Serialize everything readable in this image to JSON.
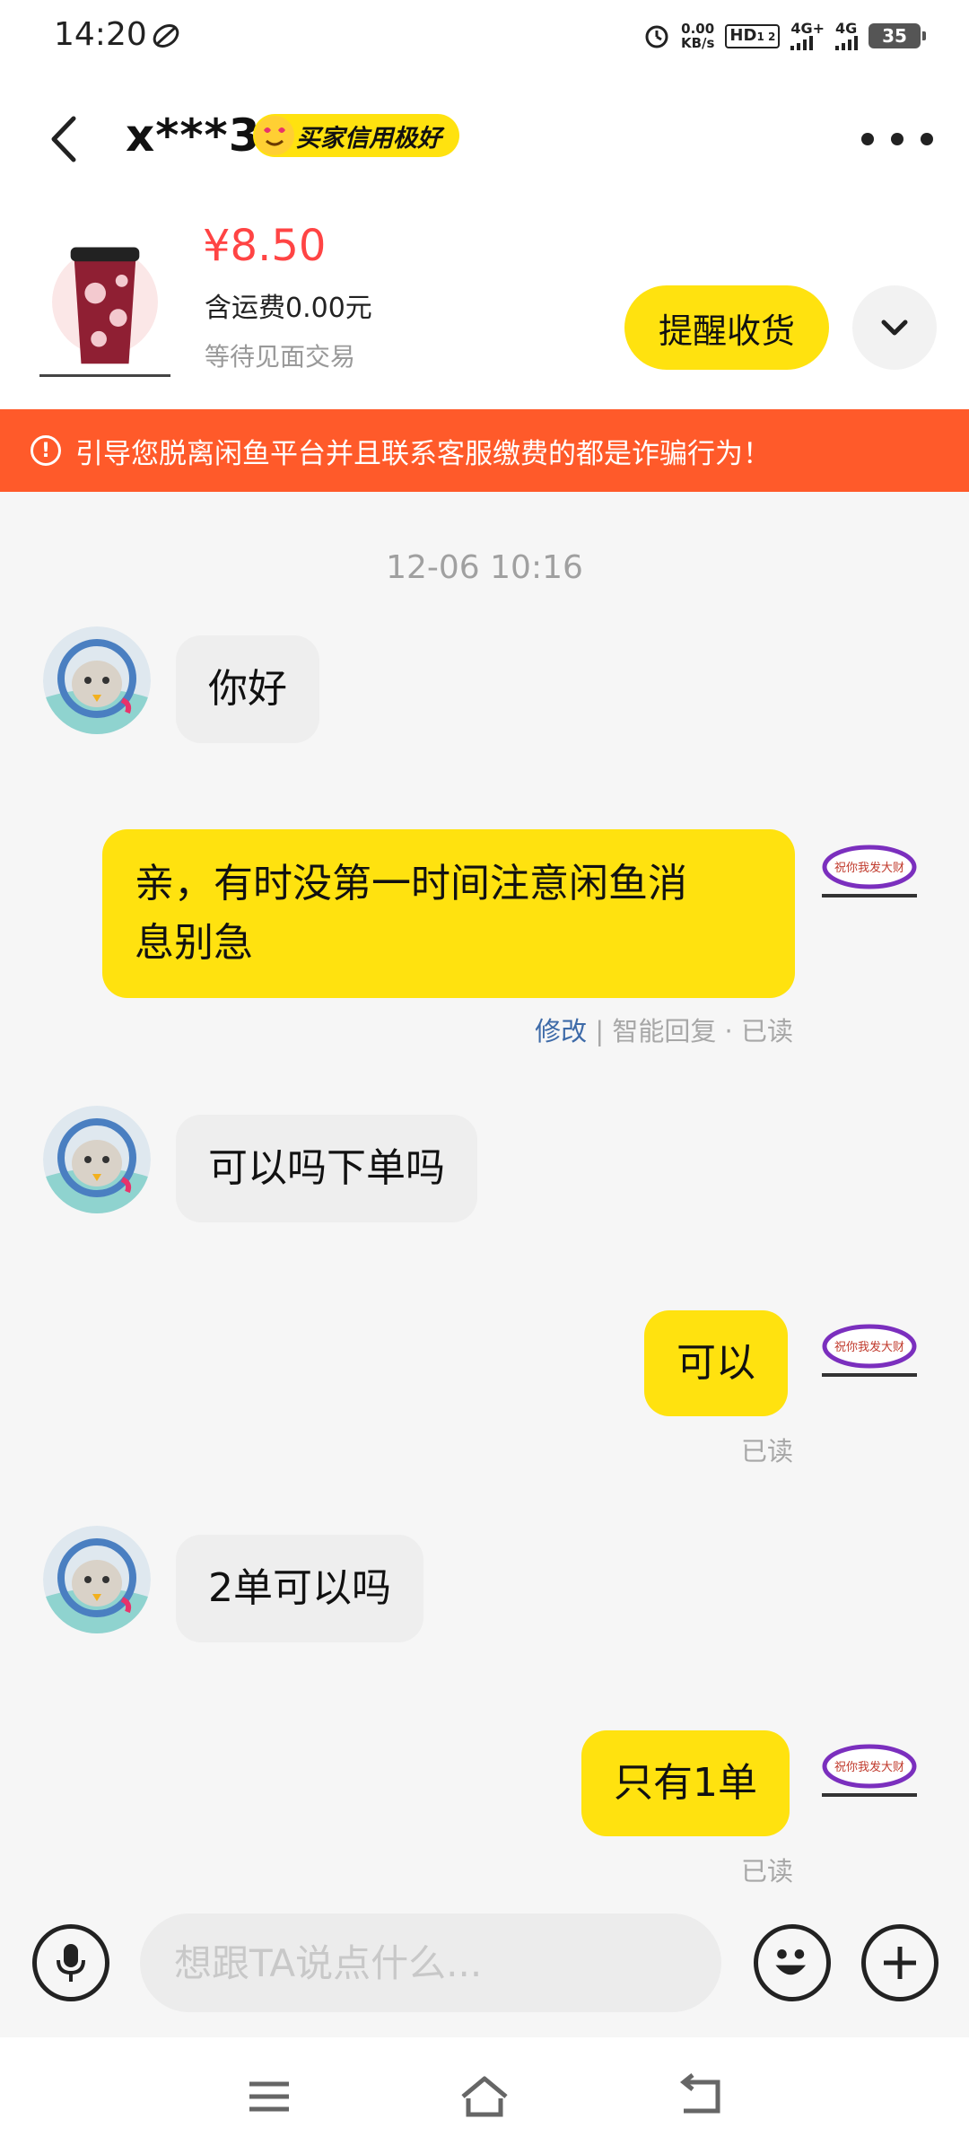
{
  "status_bar": {
    "time": "14:20",
    "net_speed_value": "0.00",
    "net_speed_unit": "KB/s",
    "hd_label": "HD",
    "hd_sims": "1 2",
    "signal1": "4G+",
    "signal2": "4G",
    "battery": "35"
  },
  "header": {
    "user_name": "x***3",
    "credit_badge": "买家信用极好"
  },
  "product": {
    "price": "¥8.50",
    "shipping": "含运费0.00元",
    "status": "等待见面交易",
    "remind_button": "提醒收货"
  },
  "warning": {
    "text": "引导您脱离闲鱼平台并且联系客服缴费的都是诈骗行为！"
  },
  "chat": {
    "timestamp": "12-06 10:16",
    "my_avatar_text": "祝你我发大财",
    "messages": [
      {
        "from": "them",
        "text": "你好"
      },
      {
        "from": "me",
        "line1": "亲，有时没第一时间注意闲鱼消",
        "line2": "息别急",
        "edit": "修改",
        "sep": " | ",
        "meta": "智能回复 · 已读"
      },
      {
        "from": "them",
        "text": "可以吗下单吗"
      },
      {
        "from": "me",
        "text": "可以",
        "meta": "已读"
      },
      {
        "from": "them",
        "text": "2单可以吗"
      },
      {
        "from": "me",
        "text": "只有1单",
        "meta": "已读"
      }
    ]
  },
  "input": {
    "placeholder": "想跟TA说点什么..."
  },
  "icons": {
    "back": "back-arrow-icon",
    "more": "more-dots-icon",
    "voice": "microphone-icon",
    "emoji": "emoji-icon",
    "plus": "plus-icon",
    "expand": "chevron-down-icon",
    "warning": "exclamation-circle-icon"
  },
  "colors": {
    "brand_yellow": "#ffe20f",
    "price_red": "#ff4444",
    "warning_orange": "#ff5a2a",
    "edit_blue": "#3d6aa8"
  }
}
